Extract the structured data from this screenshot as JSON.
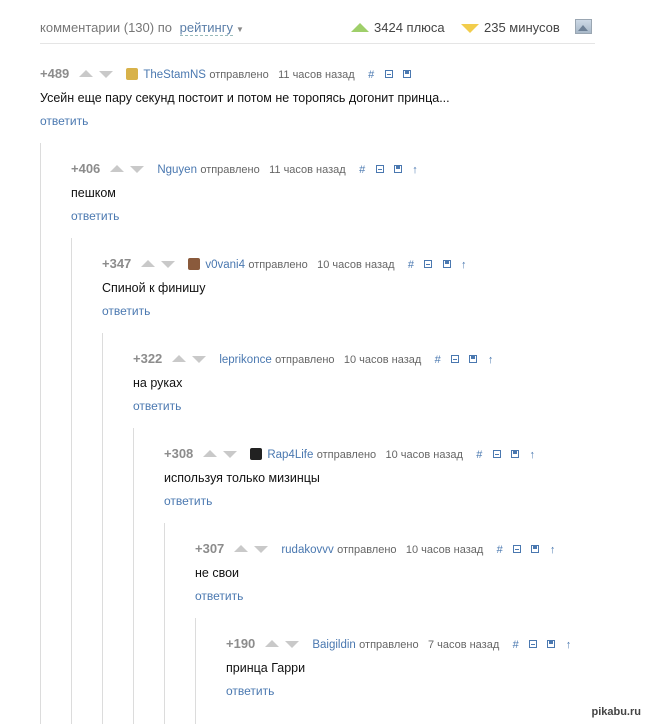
{
  "header": {
    "comments_label": "комментарии (130) по",
    "sort_label": "рейтингу",
    "plus_label": "3424 плюса",
    "minus_label": "235 минусов"
  },
  "comments": [
    {
      "score": "+489",
      "user": "TheStamNS",
      "sent": "отправлено",
      "time": "11 часов назад",
      "text": "Усейн еще пару секунд постоит и потом не торопясь догонит принца...",
      "reply": "ответить",
      "avatar": "#d8b24a"
    },
    {
      "score": "+406",
      "user": "Nguyen",
      "sent": "отправлено",
      "time": "11 часов назад",
      "text": "пешком",
      "reply": "ответить",
      "avatar": ""
    },
    {
      "score": "+347",
      "user": "v0vani4",
      "sent": "отправлено",
      "time": "10 часов назад",
      "text": "Спиной к финишу",
      "reply": "ответить",
      "avatar": "#8a5a3c"
    },
    {
      "score": "+322",
      "user": "leprikonce",
      "sent": "отправлено",
      "time": "10 часов назад",
      "text": "на руках",
      "reply": "ответить",
      "avatar": ""
    },
    {
      "score": "+308",
      "user": "Rap4Life",
      "sent": "отправлено",
      "time": "10 часов назад",
      "text": "используя только мизинцы",
      "reply": "ответить",
      "avatar": "#222222"
    },
    {
      "score": "+307",
      "user": "rudakovvv",
      "sent": "отправлено",
      "time": "10 часов назад",
      "text": "не свои",
      "reply": "ответить",
      "avatar": ""
    },
    {
      "score": "+190",
      "user": "Baigildin",
      "sent": "отправлено",
      "time": "7 часов назад",
      "text": "принца Гарри",
      "reply": "ответить",
      "avatar": ""
    }
  ],
  "action_hash": "#",
  "action_up": "↑",
  "watermark": "pikabu.ru"
}
